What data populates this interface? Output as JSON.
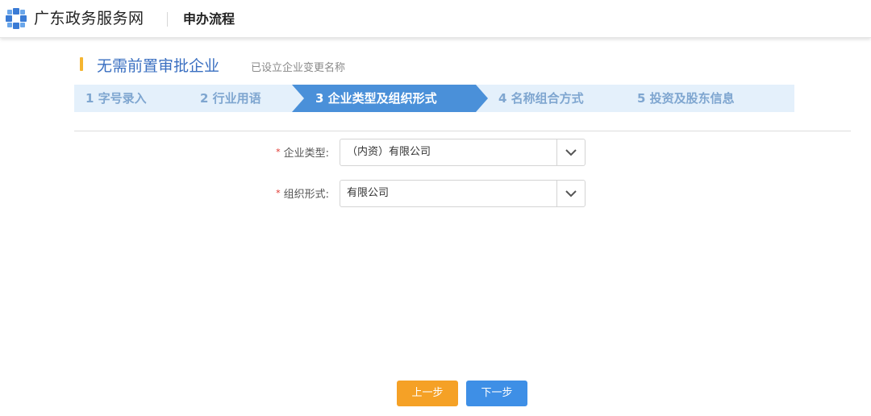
{
  "header": {
    "site_name": "广东政务服务网",
    "page_title": "申办流程",
    "logo_icon": "gd-gov-logo-icon"
  },
  "section": {
    "title": "无需前置审批企业",
    "subtitle": "已设立企业变更名称",
    "accent_color": "#f5b531"
  },
  "steps": [
    {
      "label": "1 字号录入",
      "active": false
    },
    {
      "label": "2 行业用语",
      "active": false
    },
    {
      "label": "3 企业类型及组织形式",
      "active": true
    },
    {
      "label": "4 名称组合方式",
      "active": false
    },
    {
      "label": "5 投资及股东信息",
      "active": false
    }
  ],
  "form": {
    "enterprise_type": {
      "label": "企业类型:",
      "required_mark": "*",
      "value": "（内资）有限公司"
    },
    "org_form": {
      "label": "组织形式:",
      "required_mark": "*",
      "value": "有限公司"
    }
  },
  "buttons": {
    "prev_label": "上一步",
    "next_label": "下一步",
    "prev_color": "#f5a126",
    "next_color": "#3e8fe6"
  },
  "colors": {
    "step_active": "#4a90d9",
    "step_bg": "#e4f0fb",
    "step_text": "#7fa6d0",
    "title_blue": "#3a6fc1"
  }
}
